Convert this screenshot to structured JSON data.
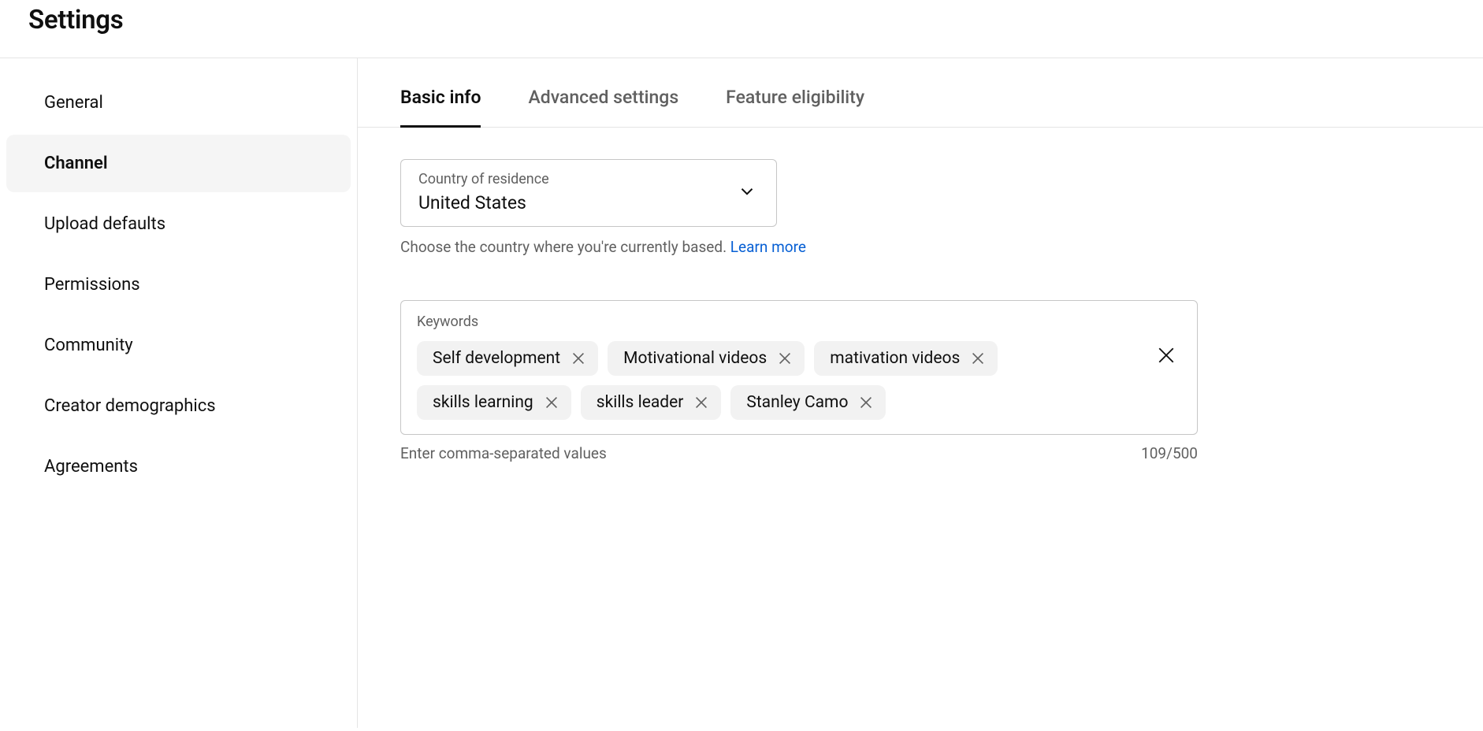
{
  "header": {
    "title": "Settings"
  },
  "sidebar": {
    "items": [
      {
        "label": "General",
        "slug": "general",
        "active": false
      },
      {
        "label": "Channel",
        "slug": "channel",
        "active": true
      },
      {
        "label": "Upload defaults",
        "slug": "upload-defaults",
        "active": false
      },
      {
        "label": "Permissions",
        "slug": "permissions",
        "active": false
      },
      {
        "label": "Community",
        "slug": "community",
        "active": false
      },
      {
        "label": "Creator demographics",
        "slug": "creator-demographics",
        "active": false
      },
      {
        "label": "Agreements",
        "slug": "agreements",
        "active": false
      }
    ]
  },
  "tabs": [
    {
      "label": "Basic info",
      "slug": "basic-info",
      "active": true
    },
    {
      "label": "Advanced settings",
      "slug": "advanced-settings",
      "active": false
    },
    {
      "label": "Feature eligibility",
      "slug": "feature-eligibility",
      "active": false
    }
  ],
  "country": {
    "label": "Country of residence",
    "value": "United States",
    "helper_text": "Choose the country where you're currently based. ",
    "learn_more": "Learn more"
  },
  "keywords": {
    "label": "Keywords",
    "chips": [
      "Self development",
      "Motivational videos",
      "mativation videos",
      "skills learning",
      "skills leader",
      "Stanley Camo"
    ],
    "helper_text": "Enter comma-separated values",
    "counter": "109/500"
  }
}
